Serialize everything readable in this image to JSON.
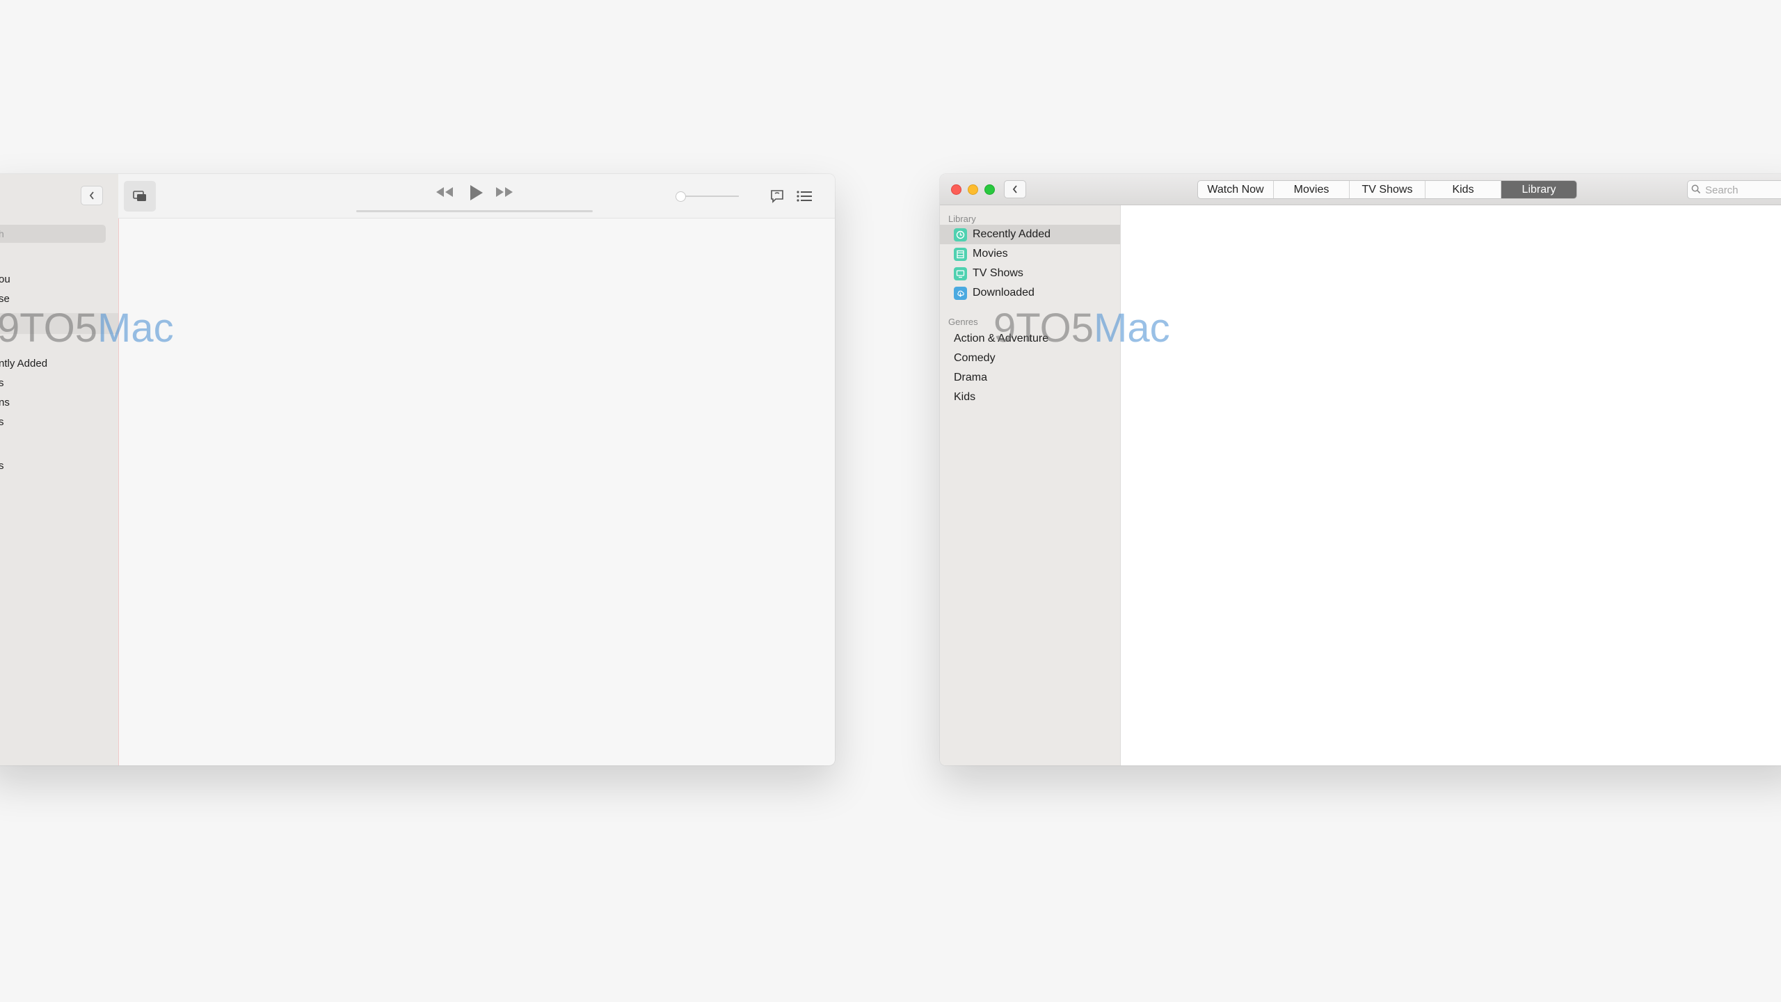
{
  "left_window": {
    "search_placeholder": "h",
    "sidebar_items": [
      "ou",
      "se",
      "ntly Added",
      "s",
      "ns",
      "s",
      "s"
    ]
  },
  "right_window": {
    "tabs": [
      {
        "label": "Watch Now",
        "active": false
      },
      {
        "label": "Movies",
        "active": false
      },
      {
        "label": "TV Shows",
        "active": false
      },
      {
        "label": "Kids",
        "active": false
      },
      {
        "label": "Library",
        "active": true
      }
    ],
    "search_placeholder": "Search",
    "sidebar": {
      "library_header": "Library",
      "library_items": [
        {
          "label": "Recently Added",
          "icon": "clock-icon",
          "color": "#4fd1b0",
          "selected": true
        },
        {
          "label": "Movies",
          "icon": "film-icon",
          "color": "#4fd1b0",
          "selected": false
        },
        {
          "label": "TV Shows",
          "icon": "tv-icon",
          "color": "#4fd1b0",
          "selected": false
        },
        {
          "label": "Downloaded",
          "icon": "download-icon",
          "color": "#4aa9e0",
          "selected": false
        }
      ],
      "genres_header": "Genres",
      "genres": [
        "Action & Adventure",
        "Comedy",
        "Drama",
        "Kids"
      ]
    }
  },
  "watermark": {
    "part_a": "9TO5",
    "part_b": "Mac"
  },
  "colors": {
    "accent_selected_tab": "#6b6b6b",
    "close": "#fc5f57",
    "minimize": "#fdbc2e",
    "zoom": "#29c83f"
  }
}
